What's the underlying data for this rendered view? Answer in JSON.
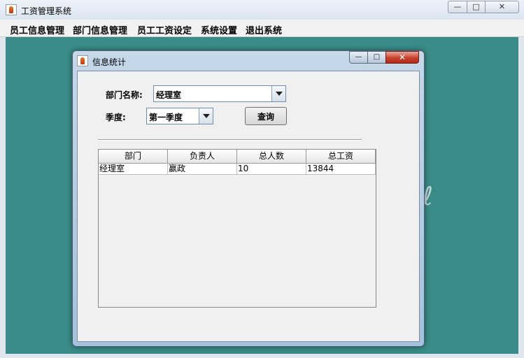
{
  "main_window": {
    "title": "工资管理系统",
    "controls": {
      "minimize": "—",
      "maximize": "□",
      "close": "✕"
    }
  },
  "menu": {
    "items": [
      "员工信息管理",
      "部门信息管理",
      "员工工资设定",
      "系统设置",
      "退出系统"
    ]
  },
  "dialog": {
    "title": "信息统计",
    "controls": {
      "minimize": "—",
      "maximize": "□",
      "close": "✕"
    },
    "department_label": "部门名称:",
    "department_value": "经理室",
    "quarter_label": "季度:",
    "quarter_value": "第一季度",
    "query_button": "查询",
    "table": {
      "columns": [
        "部门",
        "负责人",
        "总人数",
        "总工资"
      ],
      "rows": [
        [
          "经理室",
          "赢政",
          "10",
          "13844"
        ]
      ]
    }
  },
  "colors": {
    "desktop": "#3a8b89",
    "dialog_close": "#c7402c"
  }
}
